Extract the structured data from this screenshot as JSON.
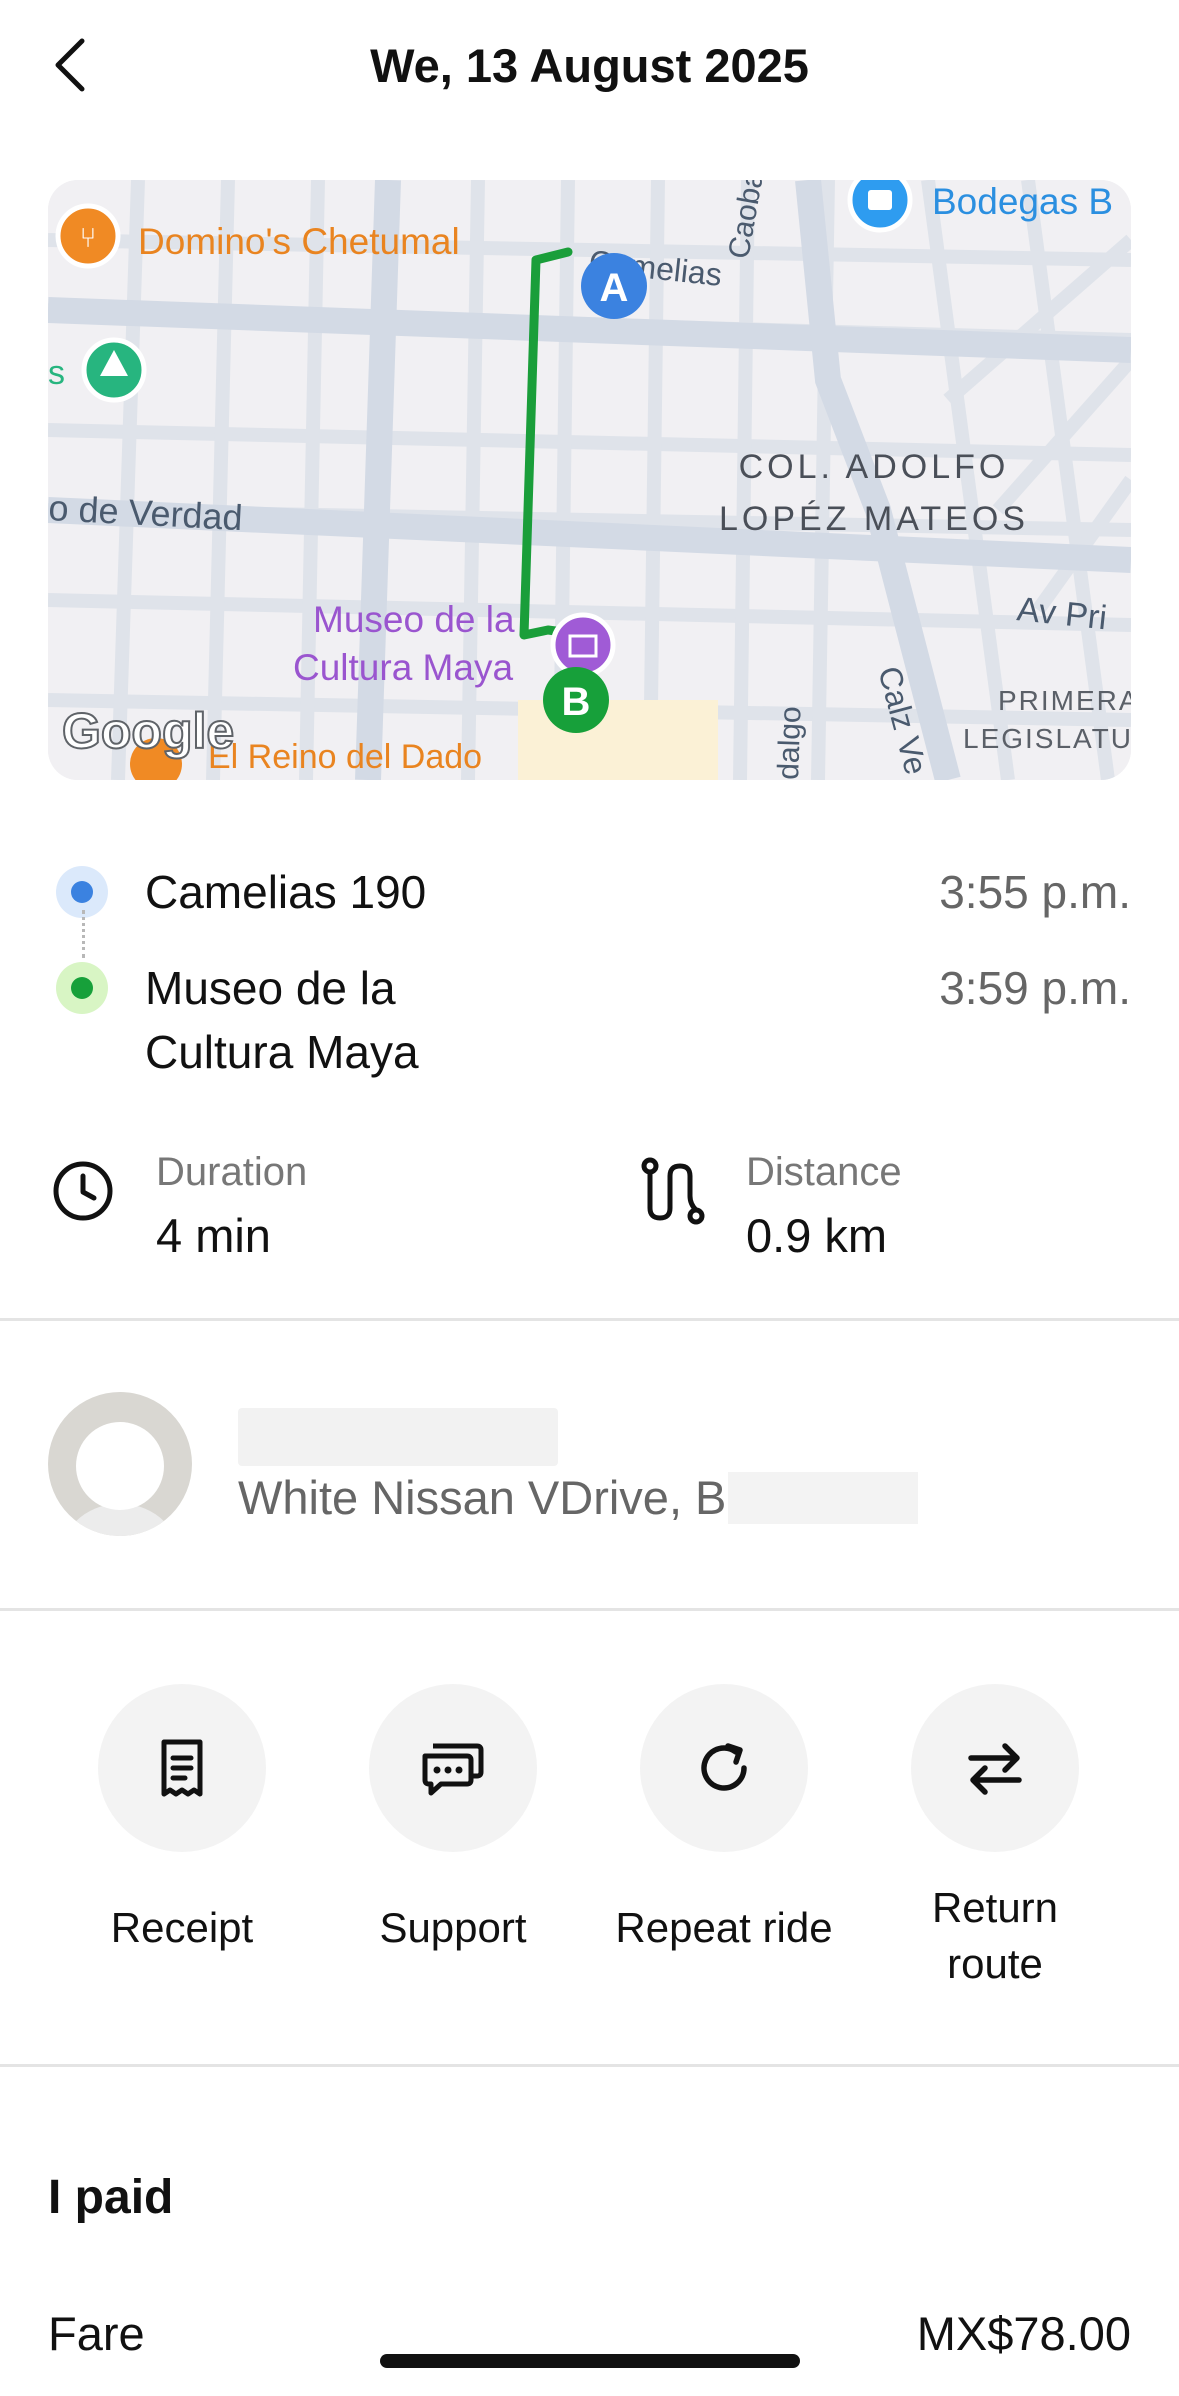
{
  "header": {
    "title": "We, 13 August 2025"
  },
  "map": {
    "attribution": "Google",
    "labels": {
      "poi_dominos": "Domino's Chetumal",
      "poi_bodegas": "Bodegas B",
      "street_camelias": "Camelias",
      "street_caoba": "Caoba",
      "street_verdad": "o de Verdad",
      "neighborhood_line1": "COL. ADOLFO",
      "neighborhood_line2": "LOPÉZ MATEOS",
      "street_av": "Av Pri",
      "poi_museo_line1": "Museo de la",
      "poi_museo_line2": "Cultura Maya",
      "poi_reino": "El Reino del Dado",
      "street_hidalgo": "dalgo",
      "street_calz": "Calz Ve",
      "area_primera_line1": "PRIMERA",
      "area_primera_line2": "LEGISLATU",
      "left_edge_s": "s",
      "marker_a": "A",
      "marker_b": "B"
    },
    "colors": {
      "route": "#1a9e3a",
      "marker_a": "#3b82e0",
      "marker_b": "#17a03a",
      "poi_orange": "#f08a24",
      "poi_purple": "#a05bd6",
      "poi_blue": "#2e9cf0",
      "poi_green": "#27b57f"
    }
  },
  "route": {
    "pickup": {
      "name": "Camelias 190",
      "time": "3:55 p.m.",
      "color": "#3b82e0"
    },
    "dropoff": {
      "name_line1": "Museo de la",
      "name_line2": "Cultura Maya",
      "time": "3:59 p.m.",
      "color": "#17a03a"
    }
  },
  "stats": {
    "duration": {
      "label": "Duration",
      "value": "4 min",
      "icon": "clock-icon"
    },
    "distance": {
      "label": "Distance",
      "value": "0.9 km",
      "icon": "route-icon"
    }
  },
  "driver": {
    "car_prefix": "White Nissan VDrive, B"
  },
  "actions": [
    {
      "label": "Receipt",
      "icon": "receipt-icon"
    },
    {
      "label": "Support",
      "icon": "chat-icon"
    },
    {
      "label": "Repeat ride",
      "icon": "repeat-icon"
    },
    {
      "label_line1": "Return",
      "label_line2": "route",
      "icon": "swap-icon"
    }
  ],
  "payment": {
    "title": "I paid",
    "fare_label": "Fare",
    "fare_value": "MX$78.00"
  }
}
